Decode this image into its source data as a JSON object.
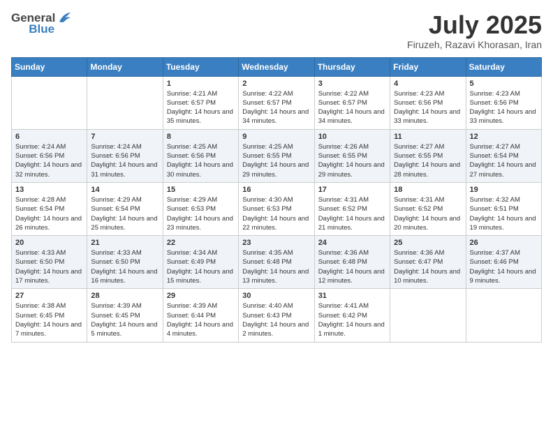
{
  "header": {
    "logo_general": "General",
    "logo_blue": "Blue",
    "month": "July 2025",
    "location": "Firuzeh, Razavi Khorasan, Iran"
  },
  "days_of_week": [
    "Sunday",
    "Monday",
    "Tuesday",
    "Wednesday",
    "Thursday",
    "Friday",
    "Saturday"
  ],
  "weeks": [
    [
      {
        "day": "",
        "sunrise": "",
        "sunset": "",
        "daylight": ""
      },
      {
        "day": "",
        "sunrise": "",
        "sunset": "",
        "daylight": ""
      },
      {
        "day": "1",
        "sunrise": "Sunrise: 4:21 AM",
        "sunset": "Sunset: 6:57 PM",
        "daylight": "Daylight: 14 hours and 35 minutes."
      },
      {
        "day": "2",
        "sunrise": "Sunrise: 4:22 AM",
        "sunset": "Sunset: 6:57 PM",
        "daylight": "Daylight: 14 hours and 34 minutes."
      },
      {
        "day": "3",
        "sunrise": "Sunrise: 4:22 AM",
        "sunset": "Sunset: 6:57 PM",
        "daylight": "Daylight: 14 hours and 34 minutes."
      },
      {
        "day": "4",
        "sunrise": "Sunrise: 4:23 AM",
        "sunset": "Sunset: 6:56 PM",
        "daylight": "Daylight: 14 hours and 33 minutes."
      },
      {
        "day": "5",
        "sunrise": "Sunrise: 4:23 AM",
        "sunset": "Sunset: 6:56 PM",
        "daylight": "Daylight: 14 hours and 33 minutes."
      }
    ],
    [
      {
        "day": "6",
        "sunrise": "Sunrise: 4:24 AM",
        "sunset": "Sunset: 6:56 PM",
        "daylight": "Daylight: 14 hours and 32 minutes."
      },
      {
        "day": "7",
        "sunrise": "Sunrise: 4:24 AM",
        "sunset": "Sunset: 6:56 PM",
        "daylight": "Daylight: 14 hours and 31 minutes."
      },
      {
        "day": "8",
        "sunrise": "Sunrise: 4:25 AM",
        "sunset": "Sunset: 6:56 PM",
        "daylight": "Daylight: 14 hours and 30 minutes."
      },
      {
        "day": "9",
        "sunrise": "Sunrise: 4:25 AM",
        "sunset": "Sunset: 6:55 PM",
        "daylight": "Daylight: 14 hours and 29 minutes."
      },
      {
        "day": "10",
        "sunrise": "Sunrise: 4:26 AM",
        "sunset": "Sunset: 6:55 PM",
        "daylight": "Daylight: 14 hours and 29 minutes."
      },
      {
        "day": "11",
        "sunrise": "Sunrise: 4:27 AM",
        "sunset": "Sunset: 6:55 PM",
        "daylight": "Daylight: 14 hours and 28 minutes."
      },
      {
        "day": "12",
        "sunrise": "Sunrise: 4:27 AM",
        "sunset": "Sunset: 6:54 PM",
        "daylight": "Daylight: 14 hours and 27 minutes."
      }
    ],
    [
      {
        "day": "13",
        "sunrise": "Sunrise: 4:28 AM",
        "sunset": "Sunset: 6:54 PM",
        "daylight": "Daylight: 14 hours and 26 minutes."
      },
      {
        "day": "14",
        "sunrise": "Sunrise: 4:29 AM",
        "sunset": "Sunset: 6:54 PM",
        "daylight": "Daylight: 14 hours and 25 minutes."
      },
      {
        "day": "15",
        "sunrise": "Sunrise: 4:29 AM",
        "sunset": "Sunset: 6:53 PM",
        "daylight": "Daylight: 14 hours and 23 minutes."
      },
      {
        "day": "16",
        "sunrise": "Sunrise: 4:30 AM",
        "sunset": "Sunset: 6:53 PM",
        "daylight": "Daylight: 14 hours and 22 minutes."
      },
      {
        "day": "17",
        "sunrise": "Sunrise: 4:31 AM",
        "sunset": "Sunset: 6:52 PM",
        "daylight": "Daylight: 14 hours and 21 minutes."
      },
      {
        "day": "18",
        "sunrise": "Sunrise: 4:31 AM",
        "sunset": "Sunset: 6:52 PM",
        "daylight": "Daylight: 14 hours and 20 minutes."
      },
      {
        "day": "19",
        "sunrise": "Sunrise: 4:32 AM",
        "sunset": "Sunset: 6:51 PM",
        "daylight": "Daylight: 14 hours and 19 minutes."
      }
    ],
    [
      {
        "day": "20",
        "sunrise": "Sunrise: 4:33 AM",
        "sunset": "Sunset: 6:50 PM",
        "daylight": "Daylight: 14 hours and 17 minutes."
      },
      {
        "day": "21",
        "sunrise": "Sunrise: 4:33 AM",
        "sunset": "Sunset: 6:50 PM",
        "daylight": "Daylight: 14 hours and 16 minutes."
      },
      {
        "day": "22",
        "sunrise": "Sunrise: 4:34 AM",
        "sunset": "Sunset: 6:49 PM",
        "daylight": "Daylight: 14 hours and 15 minutes."
      },
      {
        "day": "23",
        "sunrise": "Sunrise: 4:35 AM",
        "sunset": "Sunset: 6:48 PM",
        "daylight": "Daylight: 14 hours and 13 minutes."
      },
      {
        "day": "24",
        "sunrise": "Sunrise: 4:36 AM",
        "sunset": "Sunset: 6:48 PM",
        "daylight": "Daylight: 14 hours and 12 minutes."
      },
      {
        "day": "25",
        "sunrise": "Sunrise: 4:36 AM",
        "sunset": "Sunset: 6:47 PM",
        "daylight": "Daylight: 14 hours and 10 minutes."
      },
      {
        "day": "26",
        "sunrise": "Sunrise: 4:37 AM",
        "sunset": "Sunset: 6:46 PM",
        "daylight": "Daylight: 14 hours and 9 minutes."
      }
    ],
    [
      {
        "day": "27",
        "sunrise": "Sunrise: 4:38 AM",
        "sunset": "Sunset: 6:45 PM",
        "daylight": "Daylight: 14 hours and 7 minutes."
      },
      {
        "day": "28",
        "sunrise": "Sunrise: 4:39 AM",
        "sunset": "Sunset: 6:45 PM",
        "daylight": "Daylight: 14 hours and 5 minutes."
      },
      {
        "day": "29",
        "sunrise": "Sunrise: 4:39 AM",
        "sunset": "Sunset: 6:44 PM",
        "daylight": "Daylight: 14 hours and 4 minutes."
      },
      {
        "day": "30",
        "sunrise": "Sunrise: 4:40 AM",
        "sunset": "Sunset: 6:43 PM",
        "daylight": "Daylight: 14 hours and 2 minutes."
      },
      {
        "day": "31",
        "sunrise": "Sunrise: 4:41 AM",
        "sunset": "Sunset: 6:42 PM",
        "daylight": "Daylight: 14 hours and 1 minute."
      },
      {
        "day": "",
        "sunrise": "",
        "sunset": "",
        "daylight": ""
      },
      {
        "day": "",
        "sunrise": "",
        "sunset": "",
        "daylight": ""
      }
    ]
  ]
}
